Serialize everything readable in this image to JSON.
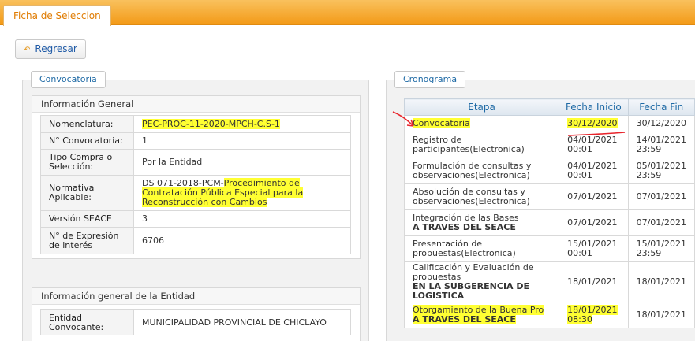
{
  "tab": {
    "label": "Ficha de Seleccion"
  },
  "back_button": {
    "label": "Regresar"
  },
  "left_panel": {
    "title": "Convocatoria",
    "general": {
      "heading": "Información General",
      "rows": [
        {
          "key": "Nomenclatura:",
          "value": "PEC-PROC-11-2020-MPCH-C.S-1"
        },
        {
          "key": "N° Convocatoria:",
          "value": "1"
        },
        {
          "key": "Tipo Compra o Selección:",
          "value": "Por la Entidad"
        },
        {
          "key": "Normativa Aplicable:",
          "value_prefix": "DS 071-2018-PCM-",
          "value_highlight": "Procedimiento de Contratación Pública Especial para la Reconstrucción con Cambios"
        },
        {
          "key": "Versión SEACE",
          "value": "3"
        },
        {
          "key": "N° de Expresión de interés",
          "value": "6706"
        }
      ]
    },
    "entity": {
      "heading": "Información general de la Entidad",
      "rows": [
        {
          "key": "Entidad Convocante:",
          "value": "MUNICIPALIDAD PROVINCIAL DE CHICLAYO"
        }
      ]
    }
  },
  "right_panel": {
    "title": "Cronograma",
    "headers": [
      "Etapa",
      "Fecha Inicio",
      "Fecha Fin"
    ],
    "rows": [
      {
        "etapa": "Convocatoria",
        "etapa2": "",
        "inicio": "30/12/2020",
        "inicio2": "",
        "fin": "30/12/2020",
        "fin2": ""
      },
      {
        "etapa": "Registro de participantes(Electronica)",
        "etapa2": "",
        "inicio": "04/01/2021",
        "inicio2": "00:01",
        "fin": "14/01/2021",
        "fin2": "23:59"
      },
      {
        "etapa": "Formulación de consultas y observaciones(Electronica)",
        "etapa2": "",
        "inicio": "04/01/2021",
        "inicio2": "00:01",
        "fin": "05/01/2021",
        "fin2": "23:59"
      },
      {
        "etapa": "Absolución de consultas y observaciones(Electronica)",
        "etapa2": "",
        "inicio": "07/01/2021",
        "inicio2": "",
        "fin": "07/01/2021",
        "fin2": ""
      },
      {
        "etapa": "Integración de las Bases",
        "etapa2": "A TRAVES DEL SEACE",
        "inicio": "07/01/2021",
        "inicio2": "",
        "fin": "07/01/2021",
        "fin2": ""
      },
      {
        "etapa": "Presentación de propuestas(Electronica)",
        "etapa2": "",
        "inicio": "15/01/2021",
        "inicio2": "00:01",
        "fin": "15/01/2021",
        "fin2": "23:59"
      },
      {
        "etapa": "Calificación y Evaluación de propuestas",
        "etapa2": "EN LA SUBGERENCIA DE LOGISTICA",
        "inicio": "18/01/2021",
        "inicio2": "",
        "fin": "18/01/2021",
        "fin2": ""
      },
      {
        "etapa": "Otorgamiento de la Buena Pro",
        "etapa2": "A TRAVES DEL SEACE",
        "inicio": "18/01/2021",
        "inicio2": "08:30",
        "fin": "18/01/2021",
        "fin2": ""
      }
    ]
  },
  "colors": {
    "accent_orange": "#f39a17",
    "link_blue": "#1f6aa5",
    "highlight": "#ffff33",
    "annotation_red": "#e8242b"
  }
}
